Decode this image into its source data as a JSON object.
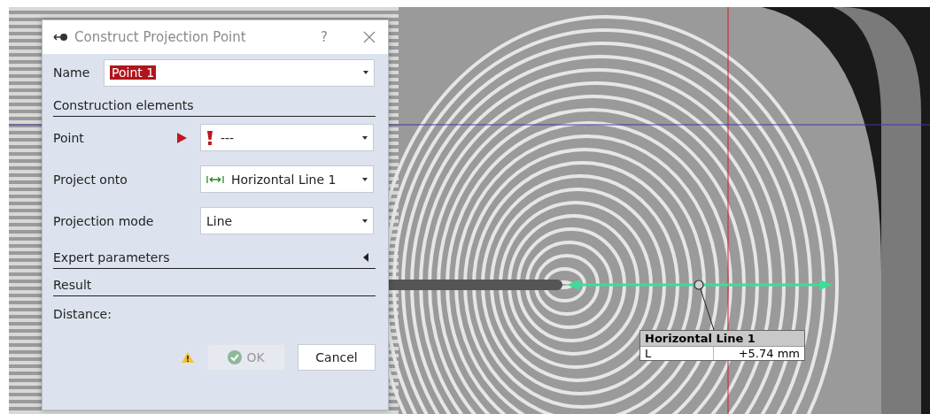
{
  "dialog": {
    "title": "Construct Projection Point",
    "help": "?"
  },
  "name_field": {
    "label": "Name",
    "value": "Point 1",
    "selected": true
  },
  "sections": [
    {
      "title": "Construction elements",
      "rows": [
        {
          "label": "Point",
          "active": true,
          "kind": "missing",
          "value": "---"
        },
        {
          "label": "Project onto",
          "active": false,
          "kind": "line",
          "value": "Horizontal Line 1"
        },
        {
          "label": "Projection mode",
          "active": false,
          "kind": "plain",
          "value": "Line"
        }
      ]
    },
    {
      "title": "Expert parameters",
      "expanded": false
    },
    {
      "title": "Result",
      "rows": [
        {
          "label": "Distance:",
          "kind": "text"
        }
      ]
    }
  ],
  "buttons": [
    {
      "label": "OK",
      "kind": "ok",
      "disabled": true
    },
    {
      "label": "Cancel",
      "kind": "cancel",
      "disabled": false
    }
  ],
  "viewer": {
    "annotation": {
      "title": "Horizontal Line 1",
      "key": "L",
      "value": "+5.74 mm"
    }
  }
}
